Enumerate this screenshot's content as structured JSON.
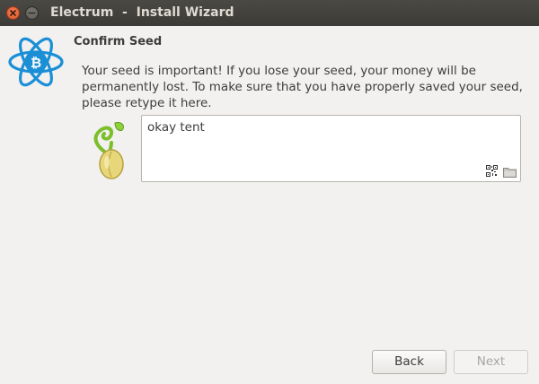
{
  "window": {
    "title": "Electrum  -  Install Wizard"
  },
  "logo": {
    "icon": "electrum-logo-icon",
    "color": "#1b8fd6"
  },
  "page": {
    "heading": "Confirm Seed",
    "message": "Your seed is important! If you lose your seed, your money will be permanently lost. To make sure that you have properly saved your seed, please retype it here."
  },
  "seed_input": {
    "value": "okay tent",
    "icons": [
      "qr-code-icon",
      "folder-icon"
    ]
  },
  "buttons": {
    "back": "Back",
    "next": "Next"
  }
}
